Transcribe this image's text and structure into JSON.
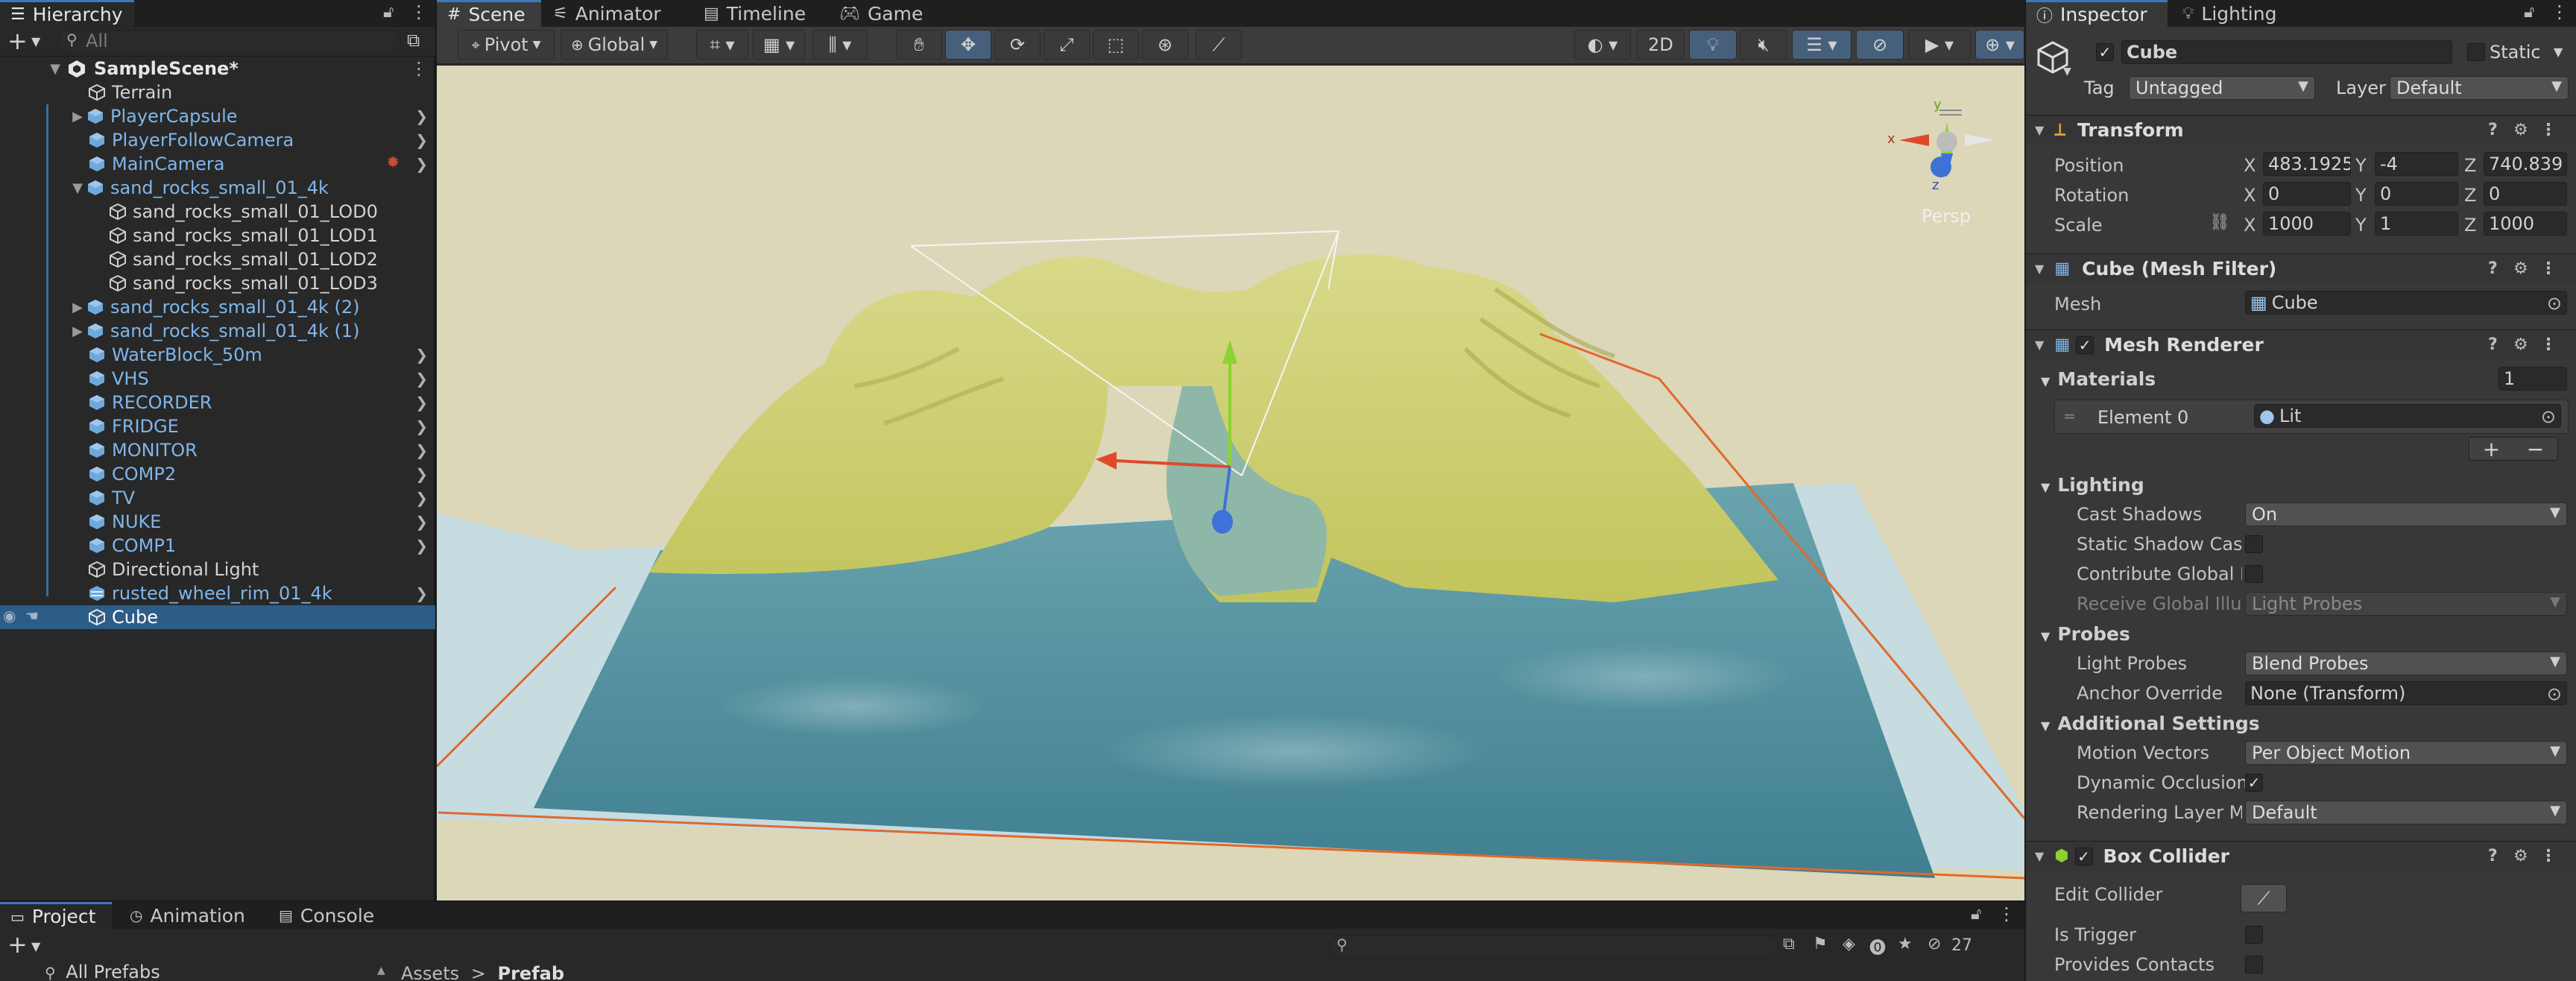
{
  "hierarchy": {
    "tab_label": "Hierarchy",
    "search_placeholder": "All",
    "scene_name": "SampleScene*",
    "items": [
      {
        "label": "Terrain"
      },
      {
        "label": "PlayerCapsule"
      },
      {
        "label": "PlayerFollowCamera"
      },
      {
        "label": "MainCamera"
      },
      {
        "label": "sand_rocks_small_01_4k"
      },
      {
        "label": "sand_rocks_small_01_LOD0"
      },
      {
        "label": "sand_rocks_small_01_LOD1"
      },
      {
        "label": "sand_rocks_small_01_LOD2"
      },
      {
        "label": "sand_rocks_small_01_LOD3"
      },
      {
        "label": "sand_rocks_small_01_4k (2)"
      },
      {
        "label": "sand_rocks_small_01_4k (1)"
      },
      {
        "label": "WaterBlock_50m"
      },
      {
        "label": "VHS"
      },
      {
        "label": "RECORDER"
      },
      {
        "label": "FRIDGE"
      },
      {
        "label": "MONITOR"
      },
      {
        "label": "COMP2"
      },
      {
        "label": "TV"
      },
      {
        "label": "NUKE"
      },
      {
        "label": "COMP1"
      },
      {
        "label": "Directional Light"
      },
      {
        "label": "rusted_wheel_rim_01_4k"
      },
      {
        "label": "Cube"
      }
    ]
  },
  "view_tabs": [
    "Scene",
    "Animator",
    "Timeline",
    "Game"
  ],
  "scene_toolbar": {
    "pivot": "Pivot",
    "global": "Global",
    "mode_2d": "2D",
    "gizmo_persp": "Persp",
    "gizmo_axes": {
      "y": "y",
      "x": "x",
      "z": "z"
    }
  },
  "inspector": {
    "tabs": [
      "Inspector",
      "Lighting"
    ],
    "object_name": "Cube",
    "static_label": "Static",
    "tag_label": "Tag",
    "tag_value": "Untagged",
    "layer_label": "Layer",
    "layer_value": "Default",
    "transform": {
      "title": "Transform",
      "rows": [
        {
          "label": "Position",
          "x": "483.1925",
          "y": "-4",
          "z": "740.839"
        },
        {
          "label": "Rotation",
          "x": "0",
          "y": "0",
          "z": "0"
        },
        {
          "label": "Scale",
          "x": "1000",
          "y": "1",
          "z": "1000"
        }
      ]
    },
    "mesh_filter": {
      "title": "Cube (Mesh Filter)",
      "mesh_label": "Mesh",
      "mesh_value": "Cube"
    },
    "mesh_renderer": {
      "title": "Mesh Renderer",
      "materials_label": "Materials",
      "materials_count": "1",
      "element_label": "Element 0",
      "element_value": "Lit",
      "lighting_label": "Lighting",
      "cast_shadows_label": "Cast Shadows",
      "cast_shadows_value": "On",
      "static_shadow_label": "Static Shadow Caster",
      "contribute_gi_label": "Contribute Global Illumination",
      "receive_gi_label": "Receive Global Illumination",
      "receive_gi_value": "Light Probes",
      "probes_label": "Probes",
      "light_probes_label": "Light Probes",
      "light_probes_value": "Blend Probes",
      "anchor_label": "Anchor Override",
      "anchor_value": "None (Transform)",
      "additional_label": "Additional Settings",
      "motion_vectors_label": "Motion Vectors",
      "motion_vectors_value": "Per Object Motion",
      "dynamic_occlusion_label": "Dynamic Occlusion",
      "rendering_layer_label": "Rendering Layer Mask",
      "rendering_layer_value": "Default"
    },
    "box_collider": {
      "title": "Box Collider",
      "edit_label": "Edit Collider",
      "trigger_label": "Is Trigger",
      "contacts_label": "Provides Contacts"
    }
  },
  "bottom": {
    "tabs": [
      "Project",
      "Animation",
      "Console"
    ],
    "all_prefabs": "All Prefabs",
    "breadcrumb": [
      "Assets",
      "Prefab"
    ],
    "hidden_count": "27"
  },
  "colors": {
    "selection": "#2c5d87",
    "accent": "#3a79bb",
    "terrain": "#cfd174",
    "water": "#4f8899",
    "sky": "#dcd7b8",
    "bounds": "#e2682c"
  }
}
